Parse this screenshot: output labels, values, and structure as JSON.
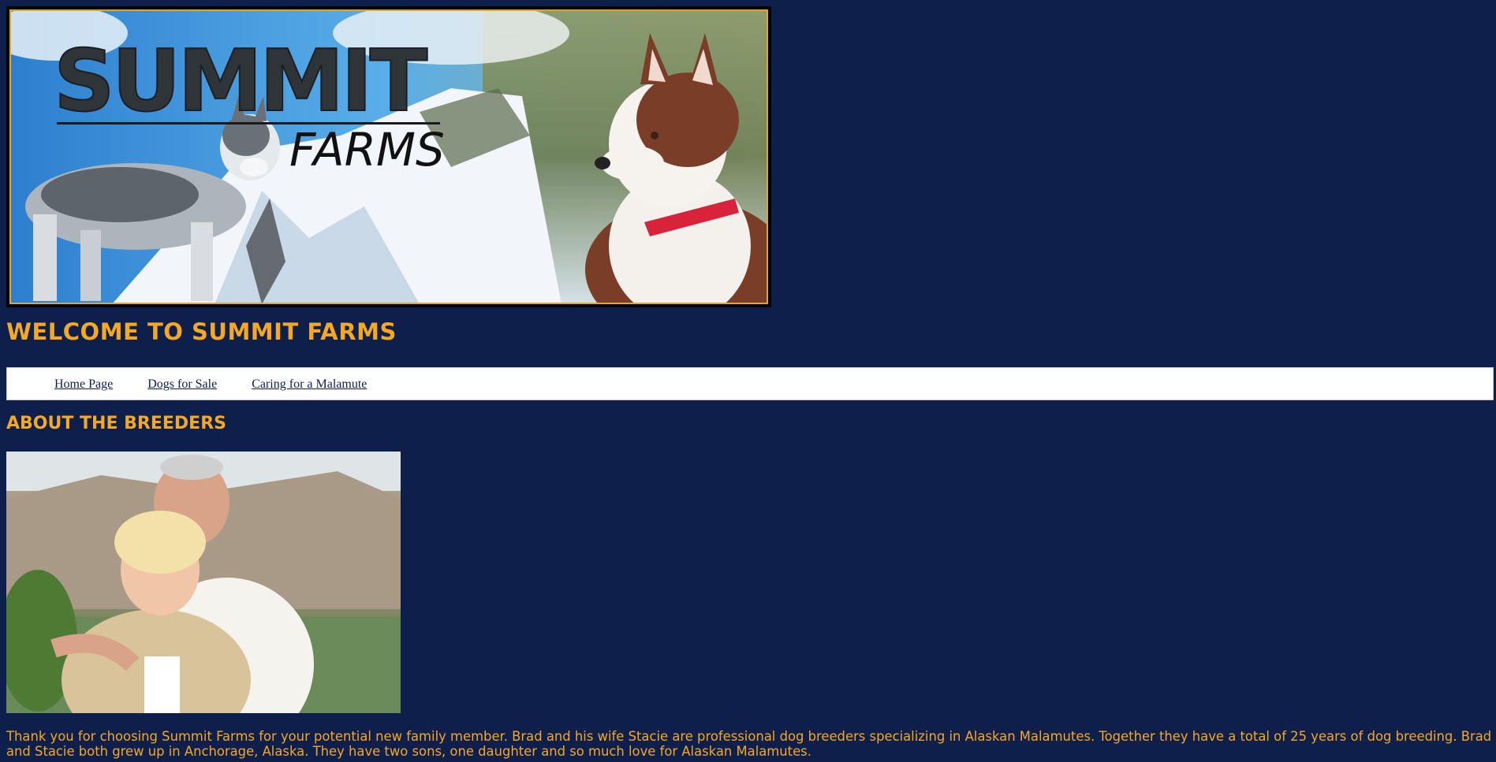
{
  "banner": {
    "logo_main": "SUMMIT",
    "logo_sub": "FARMS"
  },
  "welcome_heading": "WELCOME TO SUMMIT FARMS",
  "nav": {
    "items": [
      {
        "label": "Home Page"
      },
      {
        "label": "Dogs for Sale"
      },
      {
        "label": "Caring for a Malamute"
      }
    ]
  },
  "about_heading": "ABOUT THE BREEDERS",
  "intro_text": "Thank you for choosing Summit Farms for your potential new family member. Brad and his wife Stacie are professional dog breeders specializing in Alaskan Malamutes. Together they have a total of 25 years of dog breeding. Brad and Stacie both grew up in Anchorage, Alaska. They have two sons, one daughter and so much love for Alaskan Malamutes.",
  "colors": {
    "background": "#0f1f4c",
    "accent": "#f5a823",
    "nav_bg": "#ffffff"
  }
}
